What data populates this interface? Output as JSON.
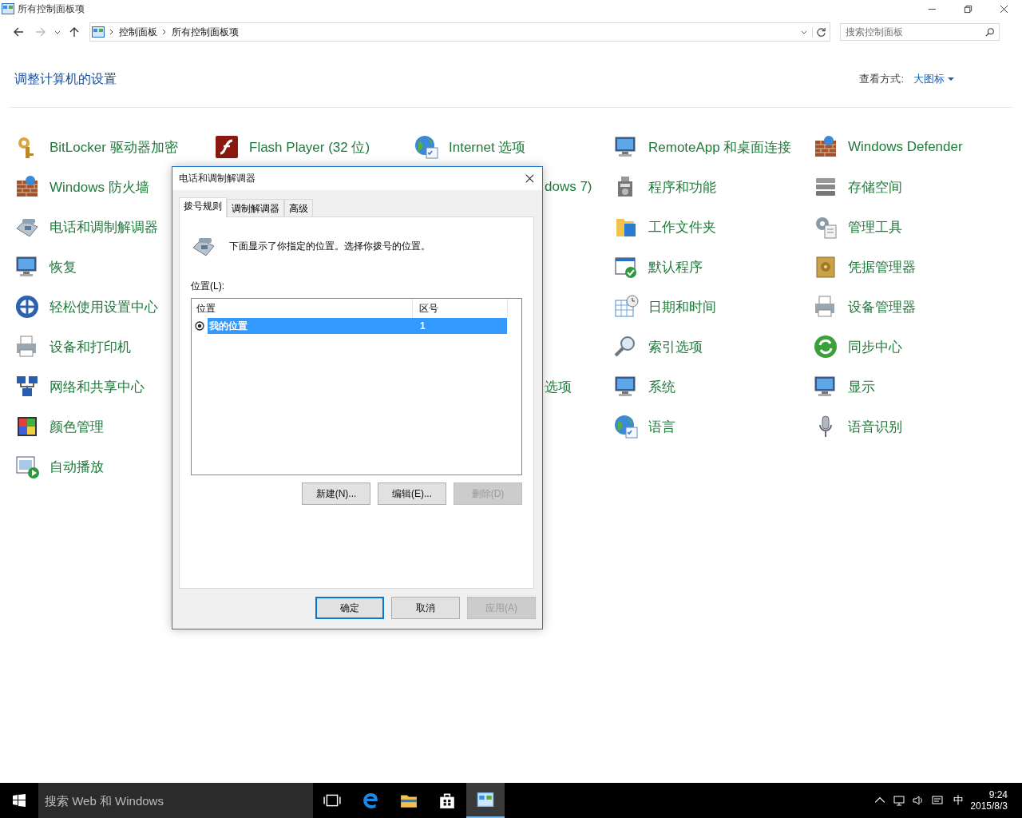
{
  "window": {
    "title": "所有控制面板项"
  },
  "address_bar": {
    "path": [
      "控制面板",
      "所有控制面板项"
    ]
  },
  "search": {
    "placeholder": "搜索控制面板"
  },
  "heading": "调整计算机的设置",
  "view_by": {
    "label": "查看方式:",
    "value": "大图标"
  },
  "applet_rows": [
    [
      {
        "label": "BitLocker 驱动器加密",
        "kind": "applet"
      },
      {
        "label": "Flash Player (32 位)",
        "kind": "applet"
      },
      {
        "label": "Internet 选项",
        "kind": "applet"
      },
      {
        "label": "RemoteApp 和桌面连接",
        "kind": "applet"
      },
      {
        "label": "Windows Defender",
        "kind": "applet"
      }
    ],
    [
      {
        "label": "Windows 防火墙",
        "kind": "applet"
      },
      null,
      {
        "label": "dows 7)",
        "kind": "partial"
      },
      {
        "label": "程序和功能",
        "kind": "applet"
      },
      {
        "label": "存储空间",
        "kind": "applet"
      }
    ],
    [
      {
        "label": "电话和调制解调器",
        "kind": "applet"
      },
      null,
      null,
      {
        "label": "工作文件夹",
        "kind": "applet"
      },
      {
        "label": "管理工具",
        "kind": "applet"
      }
    ],
    [
      {
        "label": "恢复",
        "kind": "applet"
      },
      null,
      null,
      {
        "label": "默认程序",
        "kind": "applet"
      },
      {
        "label": "凭据管理器",
        "kind": "applet"
      }
    ],
    [
      {
        "label": "轻松使用设置中心",
        "kind": "applet"
      },
      null,
      null,
      {
        "label": "日期和时间",
        "kind": "applet"
      },
      {
        "label": "设备管理器",
        "kind": "applet"
      }
    ],
    [
      {
        "label": "设备和打印机",
        "kind": "applet"
      },
      null,
      null,
      {
        "label": "索引选项",
        "kind": "applet"
      },
      {
        "label": "同步中心",
        "kind": "applet"
      }
    ],
    [
      {
        "label": "网络和共享中心",
        "kind": "applet"
      },
      null,
      {
        "label": "选项",
        "kind": "partial"
      },
      {
        "label": "系统",
        "kind": "applet"
      },
      {
        "label": "显示",
        "kind": "applet"
      }
    ],
    [
      {
        "label": "颜色管理",
        "kind": "applet"
      },
      null,
      null,
      {
        "label": "语言",
        "kind": "applet"
      },
      {
        "label": "语音识别",
        "kind": "applet"
      }
    ],
    [
      {
        "label": "自动播放",
        "kind": "applet"
      },
      null,
      null,
      null,
      null
    ]
  ],
  "dialog": {
    "title": "电话和调制解调器",
    "tabs": [
      {
        "label": "拨号规则",
        "selected": true
      },
      {
        "label": "调制解调器",
        "selected": false
      },
      {
        "label": "高级",
        "selected": false
      }
    ],
    "description": "下面显示了你指定的位置。选择你拨号的位置。",
    "list_label": "位置(L):",
    "columns": [
      "位置",
      "区号"
    ],
    "rows": [
      {
        "location": "我的位置",
        "area_code": "1",
        "selected": true,
        "current": true
      }
    ],
    "list_buttons": [
      {
        "label": "新建(N)...",
        "disabled": false
      },
      {
        "label": "编辑(E)...",
        "disabled": false
      },
      {
        "label": "删除(D)",
        "disabled": true
      }
    ],
    "buttons": [
      {
        "label": "确定",
        "default": true,
        "disabled": false
      },
      {
        "label": "取消",
        "default": false,
        "disabled": false
      },
      {
        "label": "应用(A)",
        "default": false,
        "disabled": true
      }
    ]
  },
  "taskbar": {
    "search_placeholder": "搜索 Web 和 Windows",
    "ime": "中",
    "time": "9:24",
    "date": "2015/8/3"
  }
}
